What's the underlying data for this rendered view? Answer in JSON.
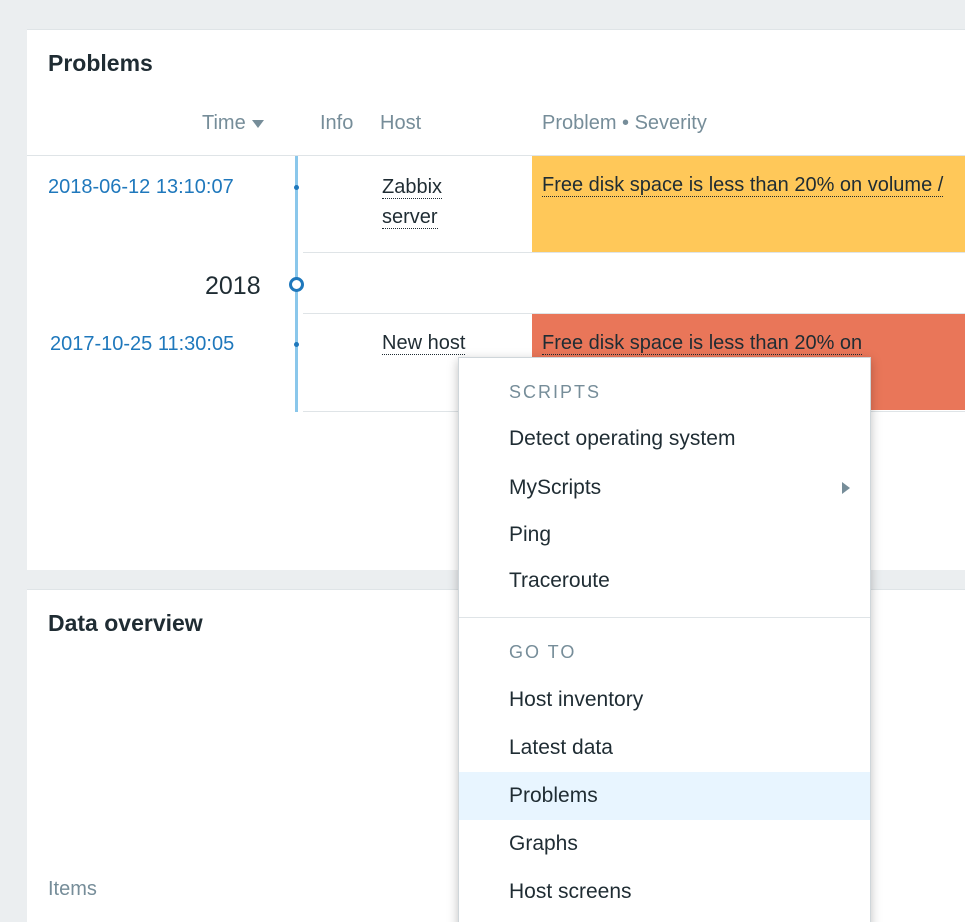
{
  "problems_widget": {
    "title": "Problems",
    "columns": {
      "time": "Time",
      "info": "Info",
      "host": "Host",
      "problem_severity": "Problem • Severity"
    },
    "year_marker": "2018",
    "rows": [
      {
        "time": "2018-06-12 13:10:07",
        "host": "Zabbix server",
        "problem": "Free disk space is less than 20% on volume /",
        "severity_color": "#ffc859"
      },
      {
        "time": "2017-10-25 11:30:05",
        "host": "New host",
        "problem": "Free disk space is less than 20% on",
        "severity_color": "#e97659"
      }
    ]
  },
  "overview_widget": {
    "title": "Data overview",
    "items_label": "Items"
  },
  "context_menu": {
    "scripts_header": "SCRIPTS",
    "scripts": [
      "Detect operating system",
      "MyScripts",
      "Ping",
      "Traceroute"
    ],
    "goto_header": "GO TO",
    "goto": [
      "Host inventory",
      "Latest data",
      "Problems",
      "Graphs",
      "Host screens"
    ],
    "active_item": "Problems"
  }
}
